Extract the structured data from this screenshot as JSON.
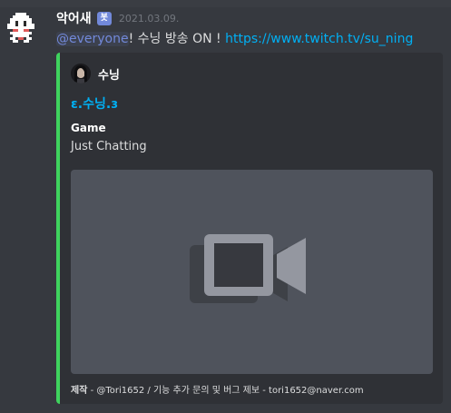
{
  "message": {
    "username": "악어새",
    "bot_tag": "봇",
    "timestamp": "2021.03.09.",
    "mention": "@everyone",
    "text": "! 수닝 방송 ON ! ",
    "link": "https://www.twitch.tv/su_ning"
  },
  "embed": {
    "accent_color": "#3fd35e",
    "author_name": "수닝",
    "title": "ɛ.수닝.ɜ",
    "field_name": "Game",
    "field_value": "Just Chatting",
    "media_icon": "video-camera-icon",
    "footer_prefix": "제작",
    "footer_text": " - @Tori1652 / 기능 추가 문의 및 버그 제보 - tori1652@naver.com"
  },
  "colors": {
    "background": "#36393f",
    "link": "#00b0f4",
    "mention": "#7289da"
  }
}
